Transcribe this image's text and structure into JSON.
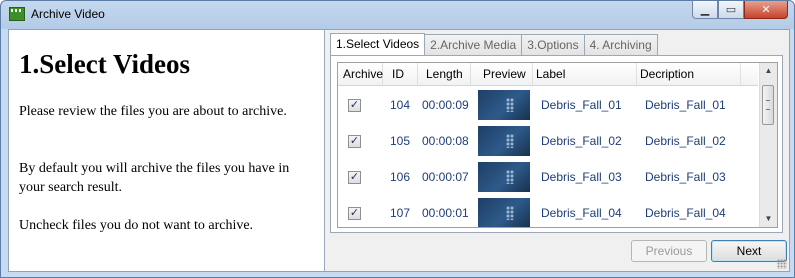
{
  "window": {
    "title": "Archive Video"
  },
  "left": {
    "heading": "1.Select Videos",
    "para1": "Please review the files you are about to archive.",
    "para2": "By default you will archive the files you have in your search result.",
    "para3": "Uncheck files you do not want to archive."
  },
  "tabs": [
    {
      "label": "1.Select Videos"
    },
    {
      "label": "2.Archive Media"
    },
    {
      "label": "3.Options"
    },
    {
      "label": "4. Archiving"
    }
  ],
  "grid": {
    "headers": {
      "archive": "Archive",
      "id": "ID",
      "length": "Length",
      "preview": "Preview",
      "label": "Label",
      "description": "Decription"
    },
    "rows": [
      {
        "checked": "✓",
        "id": "104",
        "length": "00:00:09",
        "label": "Debris_Fall_01",
        "description": "Debris_Fall_01"
      },
      {
        "checked": "✓",
        "id": "105",
        "length": "00:00:08",
        "label": "Debris_Fall_02",
        "description": "Debris_Fall_02"
      },
      {
        "checked": "✓",
        "id": "106",
        "length": "00:00:07",
        "label": "Debris_Fall_03",
        "description": "Debris_Fall_03"
      },
      {
        "checked": "✓",
        "id": "107",
        "length": "00:00:01",
        "label": "Debris_Fall_04",
        "description": "Debris_Fall_04"
      }
    ]
  },
  "buttons": {
    "previous": "Previous",
    "next": "Next"
  },
  "colors": {
    "accent": "#1f3d7a",
    "titlebar": "#c4d8ee",
    "close": "#c7432c"
  }
}
